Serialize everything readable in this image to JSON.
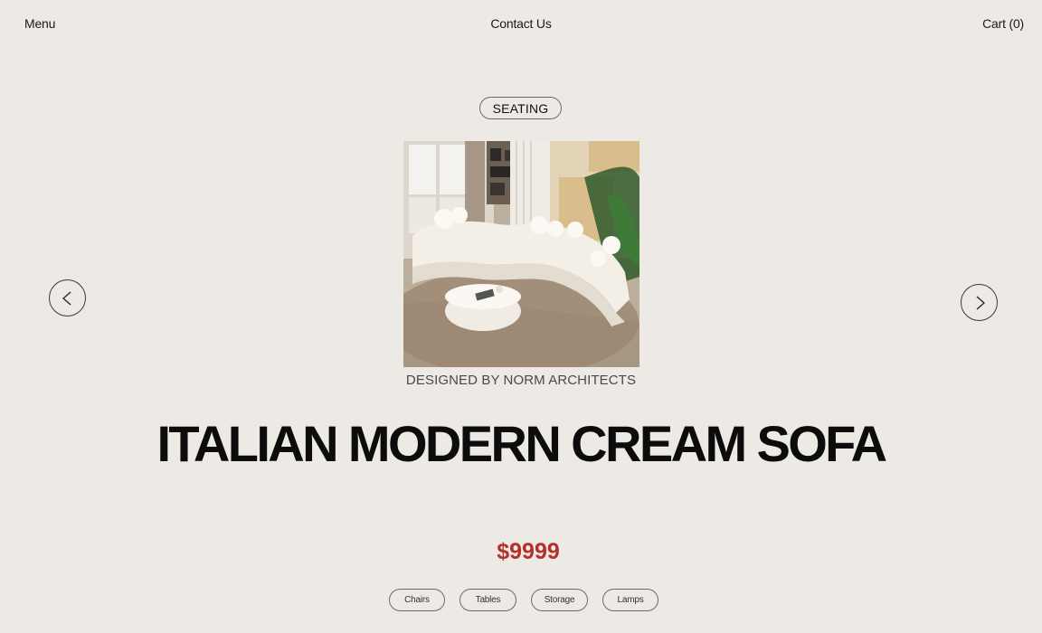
{
  "nav": {
    "menu_label": "Menu",
    "contact_label": "Contact Us",
    "cart_label": "Cart (0)"
  },
  "product": {
    "category": "SEATING",
    "designer": "DESIGNED BY NORM ARCHITECTS",
    "title": "ITALIAN MODERN CREAM SOFA",
    "price": "$9999",
    "image_subject": "cream curved sectional sofa in living room"
  },
  "filters": [
    {
      "label": "Chairs"
    },
    {
      "label": "Tables"
    },
    {
      "label": "Storage"
    },
    {
      "label": "Lamps"
    }
  ],
  "icons": {
    "prev": "chevron-left-icon",
    "next": "chevron-right-icon"
  },
  "colors": {
    "background": "#ede9e4",
    "price": "#b4302b",
    "text": "#1a1a1a"
  }
}
